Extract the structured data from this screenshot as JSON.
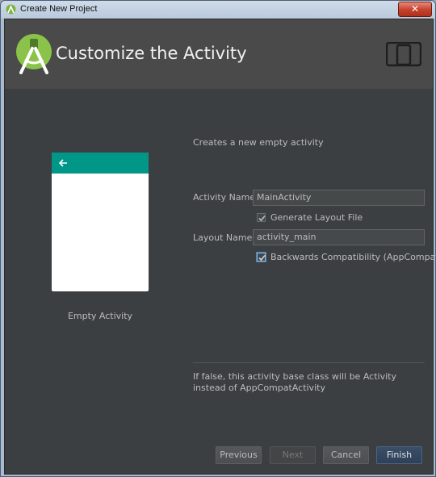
{
  "window": {
    "title": "Create New Project",
    "close_label": "✕"
  },
  "header": {
    "title": "Customize the Activity"
  },
  "template": {
    "name": "Empty Activity",
    "bar_color": "#009688"
  },
  "form": {
    "description": "Creates a new empty activity",
    "activity_name_label": "Activity Name:",
    "activity_name_value": "MainActivity",
    "generate_layout_label": "Generate Layout File",
    "generate_layout_checked": true,
    "layout_name_label": "Layout Name:",
    "layout_name_value": "activity_main",
    "backwards_compat_label": "Backwards Compatibility (AppCompat)",
    "backwards_compat_checked": true
  },
  "help": {
    "text": "If false, this activity base class will be Activity instead of AppCompatActivity"
  },
  "buttons": {
    "previous": "Previous",
    "next": "Next",
    "cancel": "Cancel",
    "finish": "Finish"
  },
  "colors": {
    "accent": "#009688",
    "android_green": "#8bc34a",
    "dialog_bg": "#3c3f41",
    "header_bg": "#4a4a4a"
  }
}
